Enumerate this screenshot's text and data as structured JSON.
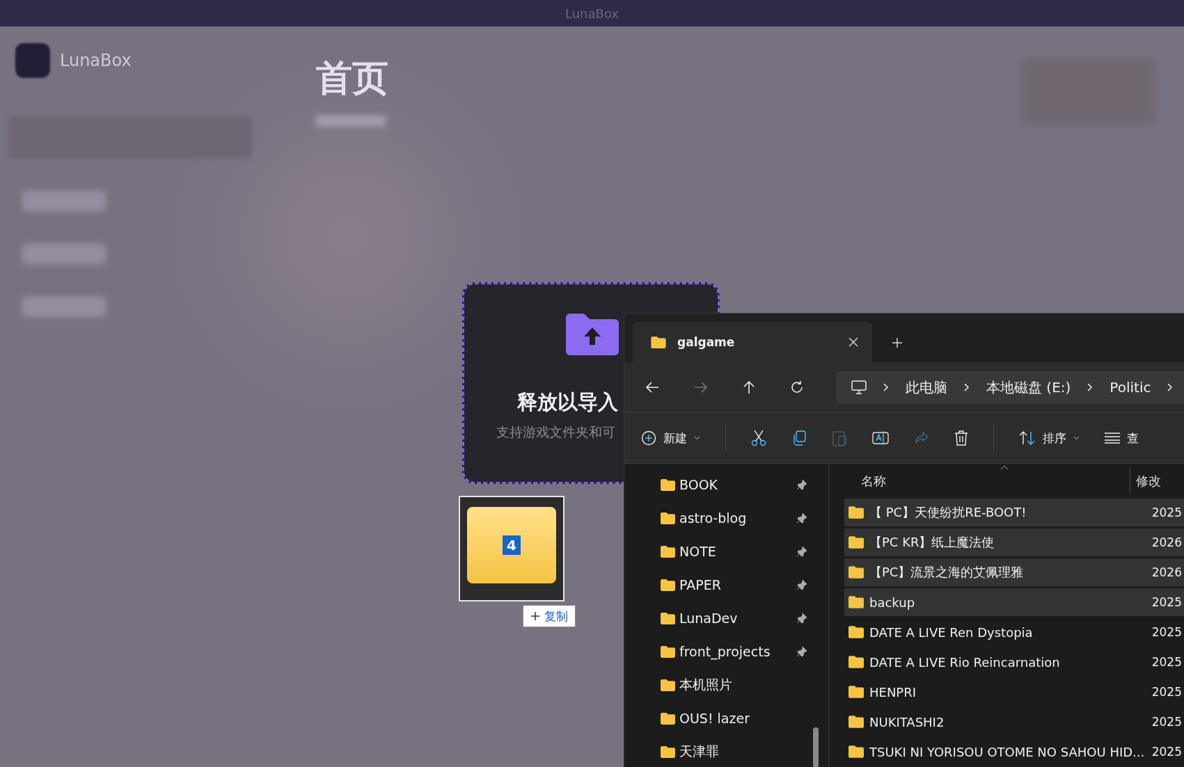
{
  "app": {
    "title": "LunaBox",
    "brand": "LunaBox",
    "page_title": "首页"
  },
  "sidebar": {
    "items": [
      {
        "selected": true
      },
      {
        "selected": false
      },
      {
        "selected": false
      },
      {
        "selected": false
      }
    ]
  },
  "drop_zone": {
    "title": "释放以导入",
    "hint": "支持游戏文件夹和可"
  },
  "drag_preview": {
    "count": "4",
    "action": "复制"
  },
  "explorer": {
    "tab": "galgame",
    "breadcrumb": [
      "此电脑",
      "本地磁盘 (E:)",
      "Politic"
    ],
    "toolbar": {
      "new": "新建",
      "sort": "排序",
      "view": "查"
    },
    "nav_items": [
      {
        "label": "BOOK",
        "pinned": true
      },
      {
        "label": "astro-blog",
        "pinned": true
      },
      {
        "label": "NOTE",
        "pinned": true
      },
      {
        "label": "PAPER",
        "pinned": true
      },
      {
        "label": "LunaDev",
        "pinned": true
      },
      {
        "label": "front_projects",
        "pinned": true
      },
      {
        "label": "本机照片",
        "pinned": false
      },
      {
        "label": "OUS! lazer",
        "pinned": false
      },
      {
        "label": "天津罪",
        "pinned": false
      }
    ],
    "columns": [
      "名称",
      "修改"
    ],
    "rows": [
      {
        "name": "【 PC】天使纷扰RE-BOOT!",
        "date": "2025",
        "selected": true
      },
      {
        "name": "【PC KR】纸上魔法使",
        "date": "2026",
        "selected": true
      },
      {
        "name": "【PC】流景之海的艾佩理雅",
        "date": "2026",
        "selected": true
      },
      {
        "name": "backup",
        "date": "2025",
        "selected": true
      },
      {
        "name": "DATE A LIVE Ren Dystopia",
        "date": "2025",
        "selected": false
      },
      {
        "name": "DATE A LIVE Rio Reincarnation",
        "date": "2025",
        "selected": false
      },
      {
        "name": "HENPRI",
        "date": "2025",
        "selected": false
      },
      {
        "name": "NUKITASHI2",
        "date": "2025",
        "selected": false
      },
      {
        "name": "TSUKI NI YORISOU OTOME NO SAHOU HID...",
        "date": "2025",
        "selected": false
      }
    ]
  }
}
